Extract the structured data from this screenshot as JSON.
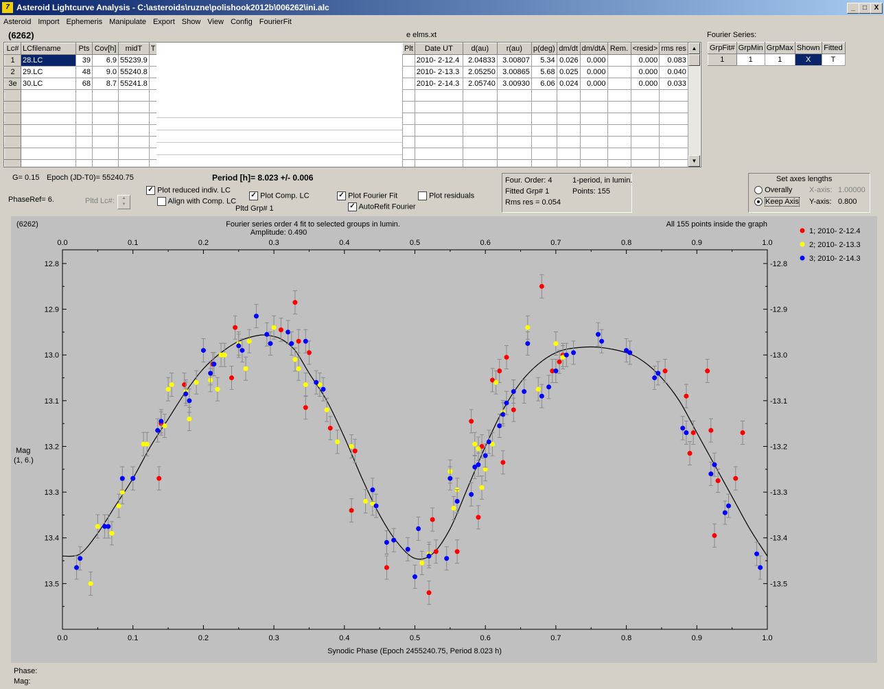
{
  "window": {
    "title": "Asteroid Lightcurve Analysis - C:\\asteroids\\ruzne\\polishook2012b\\006262\\ini.alc",
    "app_icon": "7",
    "min_label": "_",
    "max_label": "□",
    "close_label": "X"
  },
  "menu": [
    "Asteroid",
    "Import",
    "Ephemeris",
    "Manipulate",
    "Export",
    "Show",
    "View",
    "Config",
    "FourierFit"
  ],
  "asteroid_label": "(6262)",
  "elms_label": "e elms.xt",
  "lc_table": {
    "columns": [
      "Lc#",
      "LCfilename",
      "Pts",
      "Cov[h]",
      "midT",
      "T"
    ],
    "rows": [
      [
        "1",
        "28.LC",
        "39",
        "6.9",
        "55239.9"
      ],
      [
        "2",
        "29.LC",
        "48",
        "9.0",
        "55240.8"
      ],
      [
        "3e",
        "30.LC",
        "68",
        "8.7",
        "55241.8"
      ]
    ]
  },
  "geo_table": {
    "columns": [
      "Plt",
      "Date UT",
      "d(au)",
      "r(au)",
      "p(deg)",
      "dm/dt",
      "dm/dtA",
      "Rem.",
      "<resid>",
      "rms res"
    ],
    "rows": [
      [
        "2010- 2-12.4",
        "2.04833",
        "3.00807",
        "5.34",
        "0.026",
        "0.000",
        "",
        "0.000",
        "0.083"
      ],
      [
        "2010- 2-13.3",
        "2.05250",
        "3.00865",
        "5.68",
        "0.025",
        "0.000",
        "",
        "0.000",
        "0.040"
      ],
      [
        "2010- 2-14.3",
        "2.05740",
        "3.00930",
        "6.06",
        "0.024",
        "0.000",
        "",
        "0.000",
        "0.033"
      ]
    ]
  },
  "fourier_series": {
    "title": "Fourier Series:",
    "columns": [
      "GrpFit#",
      "GrpMin",
      "GrpMax",
      "Shown",
      "Fitted"
    ],
    "row": [
      "1",
      "1",
      "1",
      "X",
      "T"
    ]
  },
  "params": {
    "g": "G= 0.15",
    "epoch": "Epoch (JD-T0)= 55240.75",
    "period": "Period [h]= 8.023 +/- 0.006",
    "phase_ref": "PhaseRef= 6.",
    "pltd_lc": "Pltd Lc#:",
    "pltd_grp": "Pltd Grp#  1"
  },
  "checkboxes": {
    "plot_reduced": {
      "label": "Plot reduced indiv. LC",
      "checked": "✓"
    },
    "align_comp": {
      "label": "Align with Comp. LC",
      "checked": ""
    },
    "plot_comp": {
      "label": "Plot Comp. LC",
      "checked": "✓"
    },
    "plot_fourier": {
      "label": "Plot Fourier Fit",
      "checked": "✓"
    },
    "plot_residuals": {
      "label": "Plot residuals",
      "checked": ""
    },
    "autorefit": {
      "label": "AutoRefit Fourier",
      "checked": "✓"
    }
  },
  "fit_info": {
    "order": "Four. Order:  4",
    "mode": "1-period, in lumin.",
    "fitted": "Fitted Grp# 1",
    "points": "Points: 155",
    "rms": "Rms res      = 0.054"
  },
  "axes_panel": {
    "title": "Set axes lengths",
    "overally": "Overally",
    "keep_axis": "Keep Axis",
    "x_label": "X-axis:",
    "x_value": "1.00000",
    "y_label": "Y-axis:",
    "y_value": "0.800"
  },
  "status": {
    "phase": "Phase:",
    "mag": "Mag:"
  },
  "chart_data": {
    "type": "scatter",
    "corner_label": "(6262)",
    "title": "Fourier series order 4 fit to selected groups in lumin.",
    "subtitle": "Amplitude: 0.490",
    "note": "All 155 points inside the graph",
    "xlabel": "Synodic Phase (Epoch 2455240.75, Period 8.023 h)",
    "ylabel": "Mag",
    "ylabel2": "(1, 6.)",
    "xlim": [
      0,
      1
    ],
    "ylim": [
      13.6,
      12.77
    ],
    "y_reversed": true,
    "xticks": [
      "0.0",
      "0.1",
      "0.2",
      "0.3",
      "0.4",
      "0.5",
      "0.6",
      "0.7",
      "0.8",
      "0.9",
      "1.0"
    ],
    "yticks": [
      "12.8",
      "12.9",
      "13.0",
      "13.1",
      "13.2",
      "13.3",
      "13.4",
      "13.5"
    ],
    "legend_position": "right",
    "fit_curve": {
      "x": [
        0,
        0.025,
        0.05,
        0.075,
        0.1,
        0.125,
        0.15,
        0.175,
        0.2,
        0.225,
        0.25,
        0.275,
        0.29,
        0.31,
        0.33,
        0.35,
        0.375,
        0.4,
        0.425,
        0.45,
        0.475,
        0.5,
        0.525,
        0.55,
        0.575,
        0.6,
        0.625,
        0.65,
        0.675,
        0.7,
        0.725,
        0.76,
        0.8,
        0.825,
        0.85,
        0.875,
        0.9,
        0.925,
        0.95,
        0.975,
        1.0
      ],
      "y": [
        13.44,
        13.435,
        13.39,
        13.33,
        13.27,
        13.2,
        13.14,
        13.08,
        13.03,
        12.995,
        12.97,
        12.958,
        12.957,
        12.965,
        12.99,
        13.04,
        13.1,
        13.18,
        13.27,
        13.35,
        13.41,
        13.445,
        13.435,
        13.38,
        13.29,
        13.2,
        13.12,
        13.06,
        13.02,
        12.995,
        12.985,
        12.983,
        12.995,
        13.015,
        13.05,
        13.1,
        13.17,
        13.24,
        13.31,
        13.38,
        13.44
      ]
    },
    "series": [
      {
        "name": "1; 2010- 2-12.4",
        "color": "#ff0000",
        "x": [
          0.137,
          0.14,
          0.173,
          0.213,
          0.24,
          0.245,
          0.31,
          0.33,
          0.335,
          0.345,
          0.35,
          0.38,
          0.41,
          0.415,
          0.46,
          0.52,
          0.525,
          0.53,
          0.56,
          0.58,
          0.59,
          0.595,
          0.61,
          0.62,
          0.625,
          0.63,
          0.64,
          0.68,
          0.695,
          0.705,
          0.71,
          0.855,
          0.885,
          0.89,
          0.895,
          0.915,
          0.92,
          0.925,
          0.93,
          0.955,
          0.965
        ],
        "y": [
          13.27,
          13.15,
          13.065,
          13.02,
          13.05,
          12.94,
          12.945,
          12.885,
          12.97,
          13.115,
          12.995,
          13.16,
          13.34,
          13.21,
          13.465,
          13.52,
          13.36,
          13.43,
          13.43,
          13.145,
          13.355,
          13.2,
          13.055,
          13.035,
          13.235,
          13.005,
          13.12,
          12.85,
          13.035,
          13.015,
          13.0,
          13.035,
          13.09,
          13.215,
          13.17,
          13.035,
          13.165,
          13.395,
          13.275,
          13.27,
          13.17
        ]
      },
      {
        "name": "2; 2010- 2-13.3",
        "color": "#ffff00",
        "x": [
          0.04,
          0.05,
          0.07,
          0.08,
          0.085,
          0.115,
          0.12,
          0.145,
          0.15,
          0.155,
          0.175,
          0.18,
          0.19,
          0.21,
          0.22,
          0.225,
          0.23,
          0.25,
          0.26,
          0.265,
          0.3,
          0.33,
          0.335,
          0.345,
          0.365,
          0.375,
          0.39,
          0.41,
          0.43,
          0.44,
          0.46,
          0.51,
          0.52,
          0.55,
          0.555,
          0.56,
          0.585,
          0.59,
          0.595,
          0.6,
          0.61,
          0.615,
          0.625,
          0.64,
          0.66,
          0.675,
          0.7,
          0.71
        ],
        "y": [
          13.5,
          13.375,
          13.39,
          13.33,
          13.3,
          13.195,
          13.195,
          13.155,
          13.075,
          13.065,
          13.08,
          13.14,
          13.06,
          13.055,
          13.075,
          13.0,
          13.0,
          12.975,
          13.03,
          12.97,
          12.94,
          13.01,
          13.03,
          13.065,
          13.065,
          13.12,
          13.19,
          13.2,
          13.32,
          13.325,
          13.41,
          13.455,
          13.435,
          13.255,
          13.335,
          13.295,
          13.195,
          13.205,
          13.29,
          13.25,
          13.195,
          13.06,
          13.125,
          13.08,
          12.94,
          13.075,
          12.975,
          13.005
        ]
      },
      {
        "name": "3; 2010- 2-14.3",
        "color": "#0000ff",
        "x": [
          0.02,
          0.025,
          0.06,
          0.065,
          0.085,
          0.1,
          0.135,
          0.14,
          0.175,
          0.18,
          0.2,
          0.21,
          0.215,
          0.25,
          0.255,
          0.275,
          0.29,
          0.295,
          0.32,
          0.325,
          0.345,
          0.36,
          0.37,
          0.44,
          0.445,
          0.46,
          0.47,
          0.49,
          0.5,
          0.505,
          0.52,
          0.545,
          0.55,
          0.56,
          0.58,
          0.585,
          0.59,
          0.6,
          0.605,
          0.62,
          0.625,
          0.63,
          0.64,
          0.655,
          0.66,
          0.68,
          0.69,
          0.7,
          0.715,
          0.725,
          0.76,
          0.765,
          0.8,
          0.805,
          0.84,
          0.845,
          0.88,
          0.885,
          0.92,
          0.925,
          0.94,
          0.945,
          0.985,
          0.99
        ],
        "y": [
          13.465,
          13.445,
          13.375,
          13.375,
          13.27,
          13.27,
          13.165,
          13.145,
          13.085,
          13.1,
          12.99,
          13.04,
          13.02,
          12.98,
          12.99,
          12.915,
          12.955,
          12.975,
          12.95,
          12.975,
          12.97,
          13.06,
          13.075,
          13.295,
          13.33,
          13.41,
          13.405,
          13.425,
          13.485,
          13.38,
          13.44,
          13.445,
          13.27,
          13.32,
          13.305,
          13.245,
          13.24,
          13.22,
          13.19,
          13.155,
          13.13,
          13.105,
          13.08,
          13.08,
          12.975,
          13.09,
          13.07,
          13.035,
          13.0,
          12.995,
          12.955,
          12.97,
          12.99,
          12.995,
          13.05,
          13.04,
          13.16,
          13.17,
          13.26,
          13.24,
          13.345,
          13.33,
          13.435,
          13.465
        ]
      }
    ]
  }
}
